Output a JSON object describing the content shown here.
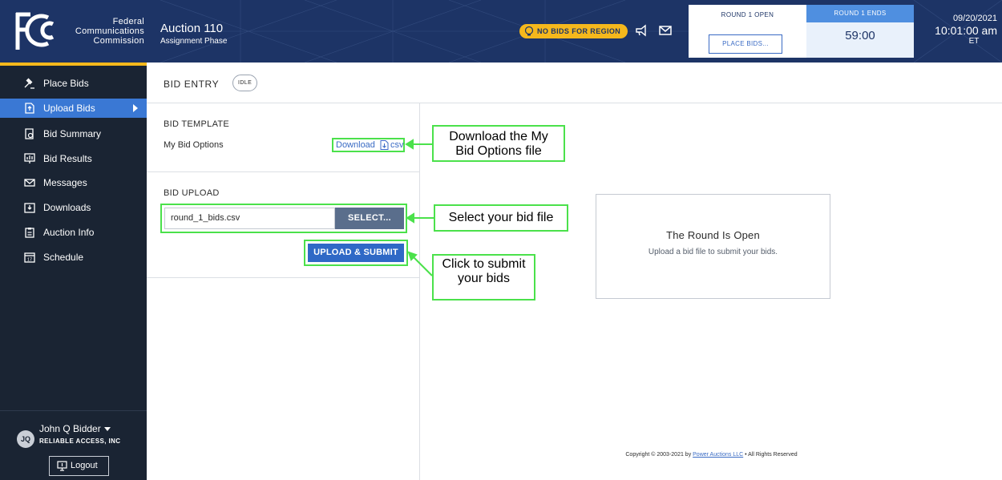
{
  "header": {
    "logo_lines": [
      "Federal",
      "Communications",
      "Commission"
    ],
    "auction_title": "Auction 110",
    "auction_phase": "Assignment Phase",
    "no_bids_badge": "NO BIDS FOR REGION",
    "round_open_label": "ROUND 1 OPEN",
    "place_bids_button": "PLACE BIDS...",
    "round_ends_label": "ROUND 1 ENDS",
    "round_ends_time": "59:00",
    "date": "09/20/2021",
    "time": "10:01:00 am",
    "timezone": "ET",
    "colors": {
      "header_bg": "#1d3466",
      "badge": "#f5b81c",
      "accent": "#4f8fe0"
    }
  },
  "sidebar": {
    "items": [
      {
        "label": "Place Bids",
        "icon": "gavel-icon",
        "active": false
      },
      {
        "label": "Upload Bids",
        "icon": "upload-file-icon",
        "active": true
      },
      {
        "label": "Bid Summary",
        "icon": "bid-summary-icon",
        "active": false
      },
      {
        "label": "Bid Results",
        "icon": "bid-results-icon",
        "active": false
      },
      {
        "label": "Messages",
        "icon": "envelope-icon",
        "active": false
      },
      {
        "label": "Downloads",
        "icon": "download-tray-icon",
        "active": false
      },
      {
        "label": "Auction Info",
        "icon": "clipboard-icon",
        "active": false
      },
      {
        "label": "Schedule",
        "icon": "calendar-icon",
        "active": false
      }
    ],
    "user": {
      "initials": "JQ",
      "name": "John Q Bidder",
      "company": "RELIABLE ACCESS, INC",
      "logout_label": "Logout"
    }
  },
  "main": {
    "title": "BID ENTRY",
    "status": "IDLE",
    "template_section": {
      "heading": "BID TEMPLATE",
      "row_label": "My Bid Options",
      "download_label": "Download",
      "csv_label": "csv"
    },
    "upload_section": {
      "heading": "BID UPLOAD",
      "file_value": "round_1_bids.csv",
      "select_label": "SELECT...",
      "submit_label": "UPLOAD & SUBMIT"
    },
    "info_card": {
      "title": "The Round Is Open",
      "subtitle": "Upload a bid file to submit your bids."
    },
    "copyright": {
      "prefix": "Copyright © 2003-2021 by ",
      "link": "Power Auctions LLC",
      "suffix": " • All Rights Reserved"
    }
  },
  "annotations": {
    "download_callout": [
      "Download the My",
      "Bid Options file"
    ],
    "select_callout": "Select your bid file",
    "submit_callout": [
      "Click to submit",
      "your bids"
    ],
    "color": "#4be14b"
  }
}
